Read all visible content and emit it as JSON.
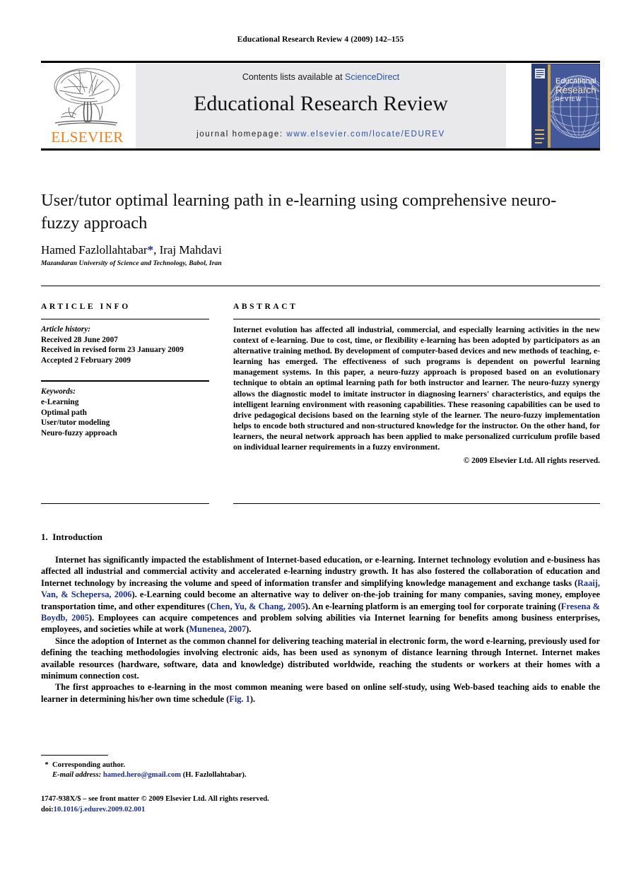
{
  "running_head": "Educational Research Review 4 (2009) 142–155",
  "masthead": {
    "contents_prefix": "Contents lists available at ",
    "contents_link": "ScienceDirect",
    "journal_title": "Educational Research Review",
    "homepage_prefix": "journal homepage: ",
    "homepage_url": "www.elsevier.com/locate/EDUREV",
    "publisher_name": "ELSEVIER",
    "cover": {
      "line1": "Educational",
      "line2": "Research",
      "line3": "REVIEW"
    }
  },
  "article": {
    "title": "User/tutor optimal learning path in e-learning using comprehensive neuro-fuzzy approach",
    "authors": "Hamed Fazlollahtabar",
    "authors_tail": ", Iraj Mahdavi",
    "corresponding_marker": "*",
    "affiliation": "Mazandaran University of Science and Technology, Babol, Iran"
  },
  "info": {
    "heading": "ARTICLE INFO",
    "history_label": "Article history:",
    "history": [
      "Received 28 June 2007",
      "Received in revised form 23 January 2009",
      "Accepted 2 February 2009"
    ],
    "keywords_label": "Keywords:",
    "keywords": [
      "e-Learning",
      "Optimal path",
      "User/tutor modeling",
      "Neuro-fuzzy approach"
    ]
  },
  "abstract": {
    "heading": "ABSTRACT",
    "text": "Internet evolution has affected all industrial, commercial, and especially learning activities in the new context of e-learning. Due to cost, time, or flexibility e-learning has been adopted by participators as an alternative training method. By development of computer-based devices and new methods of teaching, e-learning has emerged. The effectiveness of such programs is dependent on powerful learning management systems. In this paper, a neuro-fuzzy approach is proposed based on an evolutionary technique to obtain an optimal learning path for both instructor and learner. The neuro-fuzzy synergy allows the diagnostic model to imitate instructor in diagnosing learners' characteristics, and equips the intelligent learning environment with reasoning capabilities. These reasoning capabilities can be used to drive pedagogical decisions based on the learning style of the learner. The neuro-fuzzy implementation helps to encode both structured and non-structured knowledge for the instructor. On the other hand, for learners, the neural network approach has been applied to make personalized curriculum profile based on individual learner requirements in a fuzzy environment.",
    "copyright": "© 2009 Elsevier Ltd. All rights reserved."
  },
  "body": {
    "section_number": "1.",
    "section_title": "Introduction",
    "paragraph1": {
      "part1": "Internet has significantly impacted the establishment of Internet-based education, or e-learning. Internet technology evolution and e-business has affected all industrial and commercial activity and accelerated e-learning industry growth. It has also fostered the collaboration of education and Internet technology by increasing the volume and speed of information transfer and simplifying knowledge management and exchange tasks (",
      "cite1": "Raaij, Van, & Schepersa, 2006",
      "part2": "). e-Learning could become an alternative way to deliver on-the-job training for many companies, saving money, employee transportation time, and other expenditures (",
      "cite2": "Chen, Yu, & Chang, 2005",
      "part3": "). An e-learning platform is an emerging tool for corporate training (",
      "cite3": "Fresena & Boydb, 2005",
      "part4": "). Employees can acquire competences and problem solving abilities via Internet learning for benefits among business enterprises, employees, and societies while at work (",
      "cite4": "Munenea, 2007",
      "part5": ")."
    },
    "paragraph2": "Since the adoption of Internet as the common channel for delivering teaching material in electronic form, the word e-learning, previously used for defining the teaching methodologies involving electronic aids, has been used as synonym of distance learning through Internet. Internet makes available resources (hardware, software, data and knowledge) distributed worldwide, reaching the students or workers at their homes with a minimum connection cost.",
    "paragraph3": {
      "part1": "The first approaches to e-learning in the most common meaning were based on online self-study, using Web-based teaching aids to enable the learner in determining his/her own time schedule (",
      "cite1": "Fig. 1",
      "part2": ")."
    }
  },
  "footer": {
    "corresponding_marker": "*",
    "corresponding_label": "Corresponding author.",
    "email_label": "E-mail address:",
    "email": "hamed.hero@gmail.com",
    "email_owner": "(H. Fazlollahtabar).",
    "issn_line": "1747-938X/$ – see front matter © 2009 Elsevier Ltd. All rights reserved.",
    "doi_label": "doi:",
    "doi": "10.1016/j.edurev.2009.02.001"
  },
  "colors": {
    "link_blue": "#2a4fa2",
    "cite_blue": "#1c2f86",
    "elsevier_orange": "#f08019",
    "panel_grey": "#e9e9eb"
  }
}
